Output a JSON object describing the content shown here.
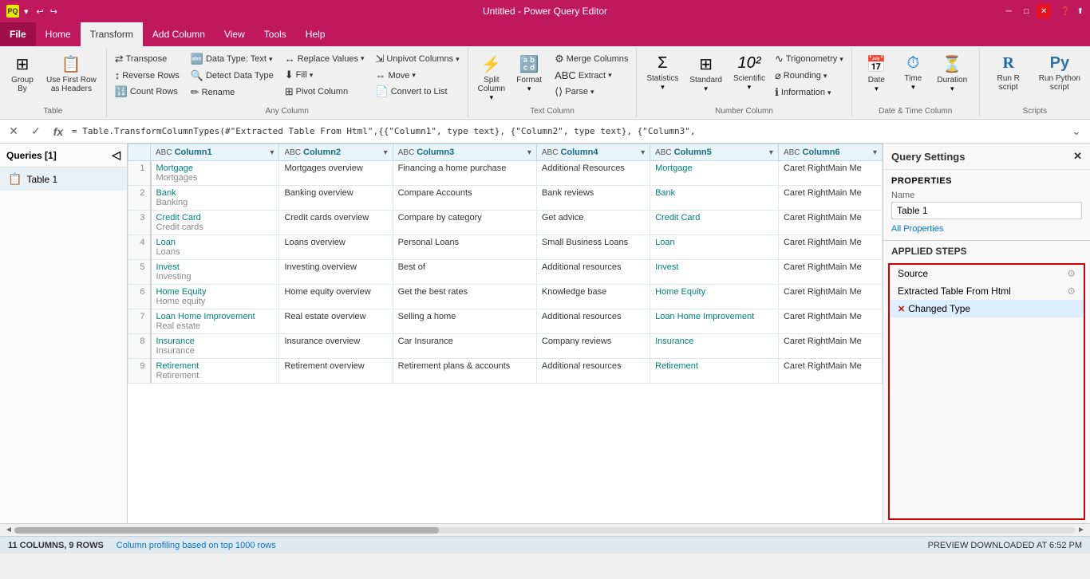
{
  "window": {
    "title": "Untitled - Power Query Editor",
    "min_btn": "─",
    "max_btn": "□",
    "close_btn": "✕"
  },
  "ribbon_tabs": {
    "file": "File",
    "home": "Home",
    "transform": "Transform",
    "add_column": "Add Column",
    "view": "View",
    "tools": "Tools",
    "help": "Help"
  },
  "ribbon": {
    "table_group": "Table",
    "any_column_group": "Any Column",
    "text_column_group": "Text Column",
    "number_column_group": "Number Column",
    "date_time_group": "Date & Time Column",
    "scripts_group": "Scripts",
    "group_by_label": "Group\nBy",
    "use_first_row_label": "Use First Row\nas Headers",
    "transpose_label": "Transpose",
    "reverse_rows_label": "Reverse Rows",
    "count_rows_label": "Count Rows",
    "data_type_label": "Data Type: Text",
    "detect_data_type_label": "Detect Data Type",
    "rename_label": "Rename",
    "replace_values_label": "Replace Values",
    "fill_label": "Fill",
    "pivot_column_label": "Pivot Column",
    "unpivot_columns_label": "Unpivot Columns",
    "move_label": "Move",
    "convert_to_list_label": "Convert to List",
    "split_column_label": "Split\nColumn",
    "format_label": "Format",
    "extract_label": "Extract",
    "parse_label": "Parse",
    "merge_columns_label": "Merge Columns",
    "statistics_label": "Statistics",
    "standard_label": "Standard",
    "scientific_label": "Scientific",
    "trigonometry_label": "Trigonometry",
    "rounding_label": "Rounding",
    "information_label": "Information",
    "date_label": "Date",
    "time_label": "Time",
    "duration_label": "Duration",
    "run_r_label": "Run R\nscript",
    "run_python_label": "Run Python\nscript"
  },
  "formula_bar": {
    "formula": "= Table.TransformColumnTypes(#\"Extracted Table From Html\",{{\"Column1\", type text}, {\"Column2\", type text}, {\"Column3\","
  },
  "queries": {
    "header": "Queries [1]",
    "items": [
      {
        "name": "Table 1",
        "icon": "📋"
      }
    ]
  },
  "table": {
    "columns": [
      {
        "type": "ABC",
        "name": "Column1",
        "has_filter": true
      },
      {
        "type": "ABC",
        "name": "Column2",
        "has_filter": true
      },
      {
        "type": "ABC",
        "name": "Column3",
        "has_filter": true
      },
      {
        "type": "ABC",
        "name": "Column4",
        "has_filter": true
      },
      {
        "type": "ABC",
        "name": "Column5",
        "has_filter": true
      },
      {
        "type": "ABC",
        "name": "Column6",
        "has_filter": true
      }
    ],
    "rows": [
      {
        "num": "1",
        "cells": [
          [
            "Mortgage",
            "Mortgages"
          ],
          [
            "Mortgages overview",
            ""
          ],
          [
            "Financing a home purchase",
            ""
          ],
          [
            "Additional Resources",
            ""
          ],
          [
            "Mortgage",
            ""
          ],
          [
            "Caret RightMain Me",
            ""
          ]
        ]
      },
      {
        "num": "2",
        "cells": [
          [
            "Bank",
            "Banking"
          ],
          [
            "Banking overview",
            ""
          ],
          [
            "Compare Accounts",
            ""
          ],
          [
            "Bank reviews",
            ""
          ],
          [
            "Bank",
            ""
          ],
          [
            "Caret RightMain Me",
            ""
          ]
        ]
      },
      {
        "num": "3",
        "cells": [
          [
            "Credit Card",
            "Credit cards"
          ],
          [
            "Credit cards overview",
            ""
          ],
          [
            "Compare by category",
            ""
          ],
          [
            "Get advice",
            ""
          ],
          [
            "Credit Card",
            ""
          ],
          [
            "Caret RightMain Me",
            ""
          ]
        ]
      },
      {
        "num": "4",
        "cells": [
          [
            "Loan",
            "Loans"
          ],
          [
            "Loans overview",
            ""
          ],
          [
            "Personal Loans",
            ""
          ],
          [
            "Small Business Loans",
            ""
          ],
          [
            "Loan",
            ""
          ],
          [
            "Caret RightMain Me",
            ""
          ]
        ]
      },
      {
        "num": "5",
        "cells": [
          [
            "Invest",
            "Investing"
          ],
          [
            "Investing overview",
            ""
          ],
          [
            "Best of",
            ""
          ],
          [
            "Additional resources",
            ""
          ],
          [
            "Invest",
            ""
          ],
          [
            "Caret RightMain Me",
            ""
          ]
        ]
      },
      {
        "num": "6",
        "cells": [
          [
            "Home Equity",
            "Home equity"
          ],
          [
            "Home equity overview",
            ""
          ],
          [
            "Get the best rates",
            ""
          ],
          [
            "Knowledge base",
            ""
          ],
          [
            "Home Equity",
            ""
          ],
          [
            "Caret RightMain Me",
            ""
          ]
        ]
      },
      {
        "num": "7",
        "cells": [
          [
            "Loan Home Improvement",
            "Real estate"
          ],
          [
            "Real estate overview",
            ""
          ],
          [
            "Selling a home",
            ""
          ],
          [
            "Additional resources",
            ""
          ],
          [
            "Loan Home Improvement",
            ""
          ],
          [
            "Caret RightMain Me",
            ""
          ]
        ]
      },
      {
        "num": "8",
        "cells": [
          [
            "Insurance",
            "Insurance"
          ],
          [
            "Insurance overview",
            ""
          ],
          [
            "Car Insurance",
            ""
          ],
          [
            "Company reviews",
            ""
          ],
          [
            "Insurance",
            ""
          ],
          [
            "Caret RightMain Me",
            ""
          ]
        ]
      },
      {
        "num": "9",
        "cells": [
          [
            "Retirement",
            "Retirement"
          ],
          [
            "Retirement overview",
            ""
          ],
          [
            "Retirement plans & accounts",
            ""
          ],
          [
            "Additional resources",
            ""
          ],
          [
            "Retirement",
            ""
          ],
          [
            "Caret RightMain Me",
            ""
          ]
        ]
      }
    ]
  },
  "settings": {
    "header": "Query Settings",
    "properties_label": "PROPERTIES",
    "name_label": "Name",
    "table_name": "Table 1",
    "all_properties_link": "All Properties",
    "applied_steps_label": "APPLIED STEPS",
    "steps": [
      {
        "name": "Source",
        "has_gear": true,
        "has_x": false,
        "active": false
      },
      {
        "name": "Extracted Table From Html",
        "has_gear": true,
        "has_x": false,
        "active": false
      },
      {
        "name": "Changed Type",
        "has_gear": false,
        "has_x": true,
        "active": true
      }
    ]
  },
  "status": {
    "columns_info": "11 COLUMNS, 9 ROWS",
    "profiling": "Column profiling based on top 1000 rows",
    "preview_time": "PREVIEW DOWNLOADED AT 6:52 PM"
  }
}
